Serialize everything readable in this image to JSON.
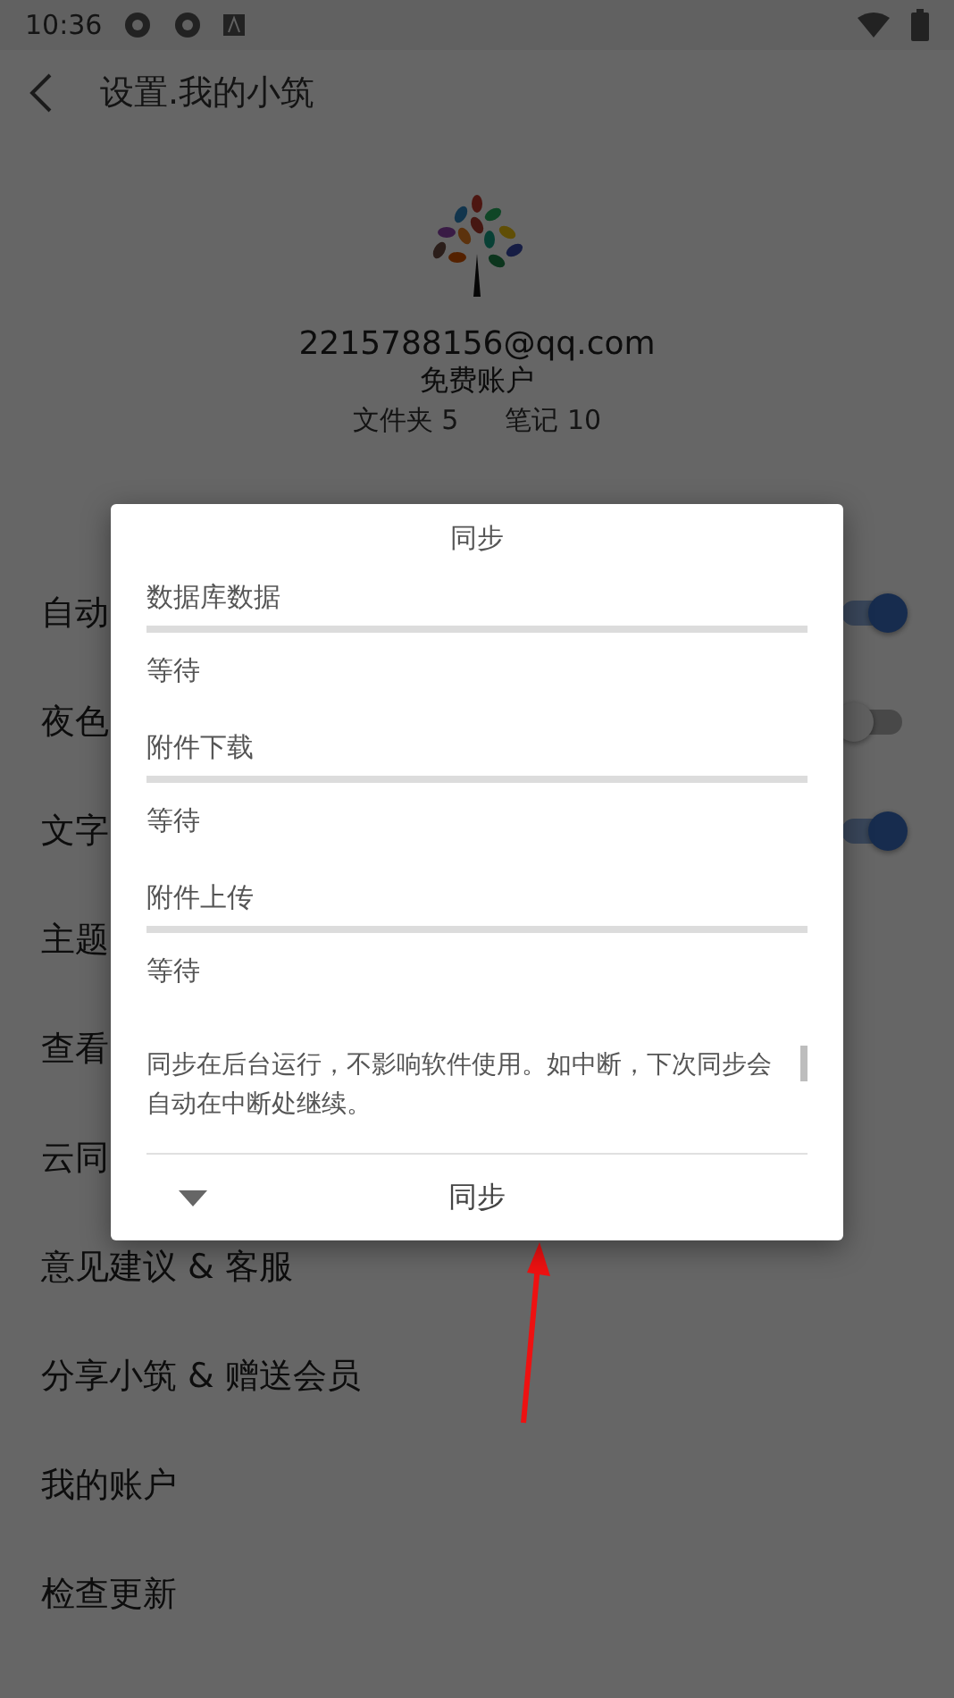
{
  "status_bar": {
    "time": "10:36"
  },
  "header": {
    "title": "设置.我的小筑"
  },
  "account": {
    "email": "2215788156@qq.com",
    "plan": "免费账户",
    "folders": "文件夹 5",
    "notes": "笔记 10"
  },
  "settings": [
    {
      "label": "自动",
      "kind": "toggle",
      "on": true
    },
    {
      "label": "夜色",
      "kind": "toggle",
      "on": false
    },
    {
      "label": "文字",
      "kind": "toggle",
      "on": true
    },
    {
      "label": "主题",
      "kind": "plain"
    },
    {
      "label": "查看",
      "kind": "plain"
    },
    {
      "label": "云同",
      "kind": "plain"
    },
    {
      "label": "意见建议 & 客服",
      "kind": "plain"
    },
    {
      "label": "分享小筑 & 赠送会员",
      "kind": "plain"
    },
    {
      "label": "我的账户",
      "kind": "plain"
    },
    {
      "label": "检查更新",
      "kind": "plain"
    }
  ],
  "dialog": {
    "title": "同步",
    "tasks": [
      {
        "name": "数据库数据",
        "level": 0,
        "status": "等待"
      },
      {
        "name": "附件下载",
        "level": 0,
        "status": "等待"
      },
      {
        "name": "附件上传",
        "level": 0,
        "status": "等待"
      }
    ],
    "note": "同步在后台运行，不影响软件使用。如中断，下次同步会自动在中断处继续。",
    "button": "同步"
  }
}
